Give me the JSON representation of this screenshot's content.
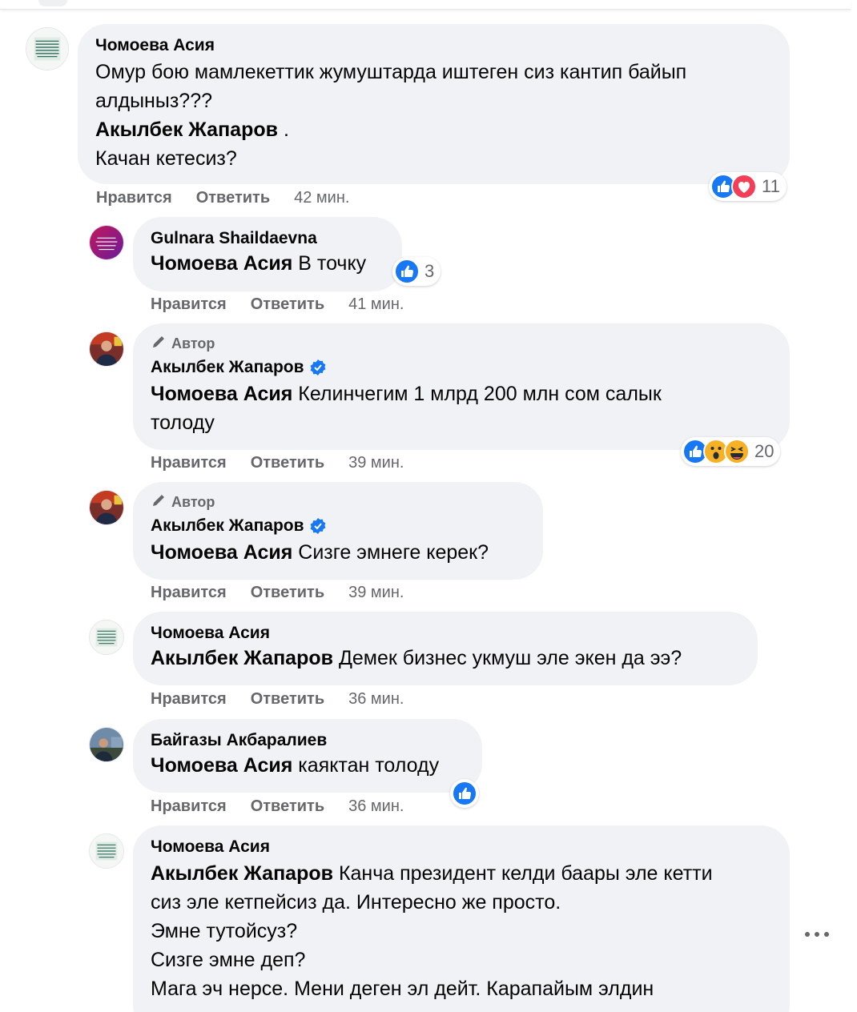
{
  "comments": [
    {
      "author": "Чомоева Асия",
      "text_lines": [
        "Омур бою мамлекеттик жумуштарда иштеген сиз кантип байып",
        "алдыныз???"
      ],
      "mention": "Акылбек Жапаров",
      "mention_suffix": " .",
      "text_after": "Качан кетесиз?",
      "like_label": "Нравится",
      "reply_label": "Ответить",
      "time": "42 мин.",
      "reactions": {
        "icons": [
          "like-icon",
          "love-icon"
        ],
        "count": "11"
      }
    },
    {
      "author": "Gulnara Shaildaevna",
      "mention": "Чомоева Асия",
      "text": "В точку",
      "like_label": "Нравится",
      "reply_label": "Ответить",
      "time": "41 мин.",
      "reactions": {
        "icons": [
          "like-icon"
        ],
        "count": "3"
      }
    },
    {
      "badge": "Автор",
      "author": "Акылбек Жапаров",
      "verified": true,
      "mention": "Чомоева Асия",
      "text": "Келинчегим 1 млрд 200 млн сом салык",
      "text_line2": "толоду",
      "like_label": "Нравится",
      "reply_label": "Ответить",
      "time": "39 мин.",
      "reactions": {
        "icons": [
          "like-icon",
          "wow-icon",
          "haha-icon"
        ],
        "count": "20"
      }
    },
    {
      "badge": "Автор",
      "author": "Акылбек Жапаров",
      "verified": true,
      "mention": "Чомоева Асия",
      "text": "Сизге эмнеге керек?",
      "like_label": "Нравится",
      "reply_label": "Ответить",
      "time": "39 мин."
    },
    {
      "author": "Чомоева Асия",
      "mention": "Акылбек Жапаров",
      "text": "Демек бизнес укмуш эле экен да ээ?",
      "like_label": "Нравится",
      "reply_label": "Ответить",
      "time": "36 мин."
    },
    {
      "author": "Байгазы Акбаралиев",
      "mention": "Чомоева Асия",
      "text": "каяктан толоду",
      "like_label": "Нравится",
      "reply_label": "Ответить",
      "time": "36 мин.",
      "reactions": {
        "icons": [
          "like-icon"
        ],
        "count": ""
      }
    },
    {
      "author": "Чомоева Асия",
      "mention": "Акылбек Жапаров",
      "text": "Канча президент келди баары эле кетти",
      "text_lines": [
        "сиз эле кетпейсиз да. Интересно же просто.",
        "Эмне тутойсуз?",
        "Сизге эмне деп?",
        "Мага эч нерсе. Мени деген эл дейт. Карапайым элдин"
      ]
    }
  ],
  "colors": {
    "bubble": "#f0f2f5",
    "muted": "#65676b",
    "like_blue": "#1877f2",
    "love_red": "#f33e58",
    "haha_yellow": "#f7b125"
  }
}
